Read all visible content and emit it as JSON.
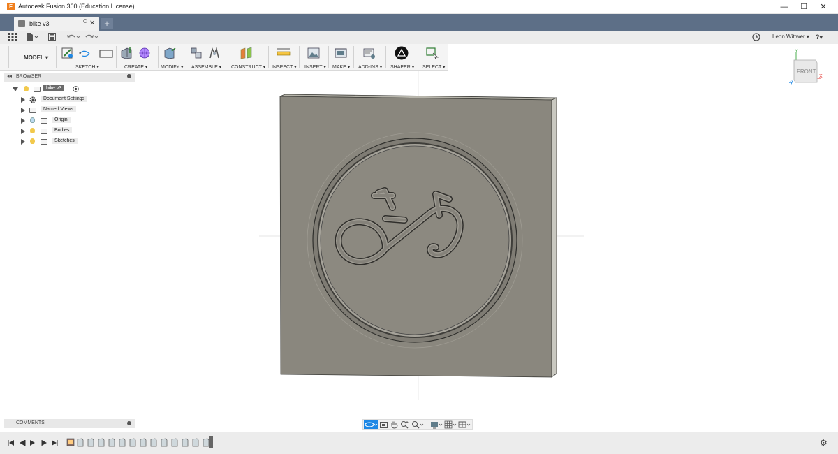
{
  "window": {
    "title": "Autodesk Fusion 360 (Education License)",
    "app_icon_letter": "F",
    "minimize": "—",
    "maximize": "☐",
    "close": "✕"
  },
  "tabs": {
    "active_label": "bike v3",
    "close_glyph": "✕",
    "new_tab_glyph": "+"
  },
  "quickbar": {
    "user": "Leon Wittwer ▾",
    "help": "?▾"
  },
  "ribbon": {
    "mode": "MODEL ▾",
    "groups": [
      {
        "label": "SKETCH ▾"
      },
      {
        "label": "CREATE ▾"
      },
      {
        "label": "MODIFY ▾"
      },
      {
        "label": "ASSEMBLE ▾"
      },
      {
        "label": "CONSTRUCT ▾"
      },
      {
        "label": "INSPECT ▾"
      },
      {
        "label": "INSERT ▾"
      },
      {
        "label": "MAKE ▾"
      },
      {
        "label": "ADD-INS ▾"
      },
      {
        "label": "SHAPER ▾"
      },
      {
        "label": "SELECT ▾"
      }
    ]
  },
  "browser": {
    "title": "BROWSER",
    "root": "bike v3",
    "items": [
      {
        "label": "Document Settings"
      },
      {
        "label": "Named Views"
      },
      {
        "label": "Origin"
      },
      {
        "label": "Bodies"
      },
      {
        "label": "Sketches"
      }
    ]
  },
  "viewcube": {
    "face": "FRONT",
    "axis_x": "X",
    "axis_y": "Y",
    "axis_z": "Z"
  },
  "comments": {
    "title": "COMMENTS"
  },
  "colors": {
    "tab_bar": "#5d6f87",
    "model_gray": "#8a877e",
    "accent_blue": "#1e88e5"
  }
}
